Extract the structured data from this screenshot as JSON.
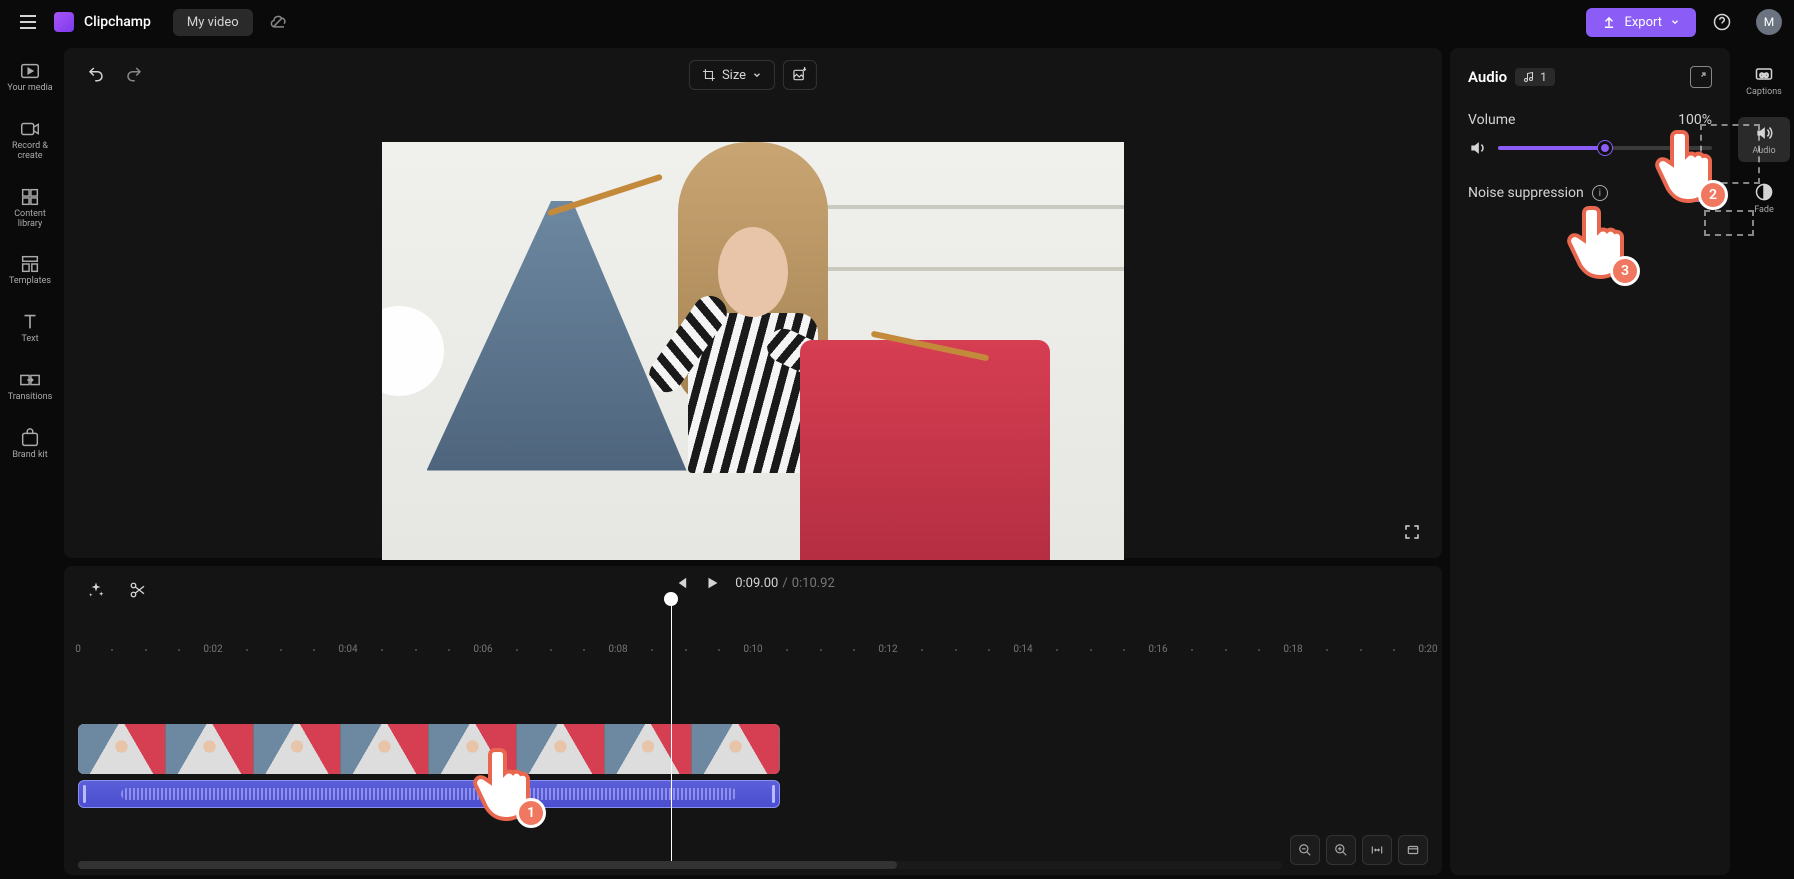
{
  "header": {
    "brand": "Clipchamp",
    "title": "My video",
    "export_label": "Export",
    "avatar_initial": "M"
  },
  "left_sidebar": [
    {
      "id": "your-media",
      "label": "Your media"
    },
    {
      "id": "record-create",
      "label": "Record & create"
    },
    {
      "id": "content-library",
      "label": "Content library"
    },
    {
      "id": "templates",
      "label": "Templates"
    },
    {
      "id": "text",
      "label": "Text"
    },
    {
      "id": "transitions",
      "label": "Transitions"
    },
    {
      "id": "brand-kit",
      "label": "Brand kit"
    }
  ],
  "right_sidebar": [
    {
      "id": "captions",
      "label": "Captions"
    },
    {
      "id": "audio",
      "label": "Audio"
    },
    {
      "id": "fade",
      "label": "Fade"
    }
  ],
  "preview_toolbar": {
    "size_label": "Size"
  },
  "audio_panel": {
    "title": "Audio",
    "clip_count": "1",
    "volume_label": "Volume",
    "volume_value": "100%",
    "volume_percent": 50,
    "noise_label": "Noise suppression",
    "noise_enabled": true
  },
  "timeline": {
    "current_time": "0:09.00",
    "total_time": "0:10.92",
    "separator": "/",
    "ruler": [
      "0",
      "0:02",
      "0:04",
      "0:06",
      "0:08",
      "0:10",
      "0:12",
      "0:14",
      "0:16",
      "0:18",
      "0:20"
    ]
  },
  "callouts": {
    "hand1": "1",
    "hand2": "2",
    "hand3": "3"
  }
}
